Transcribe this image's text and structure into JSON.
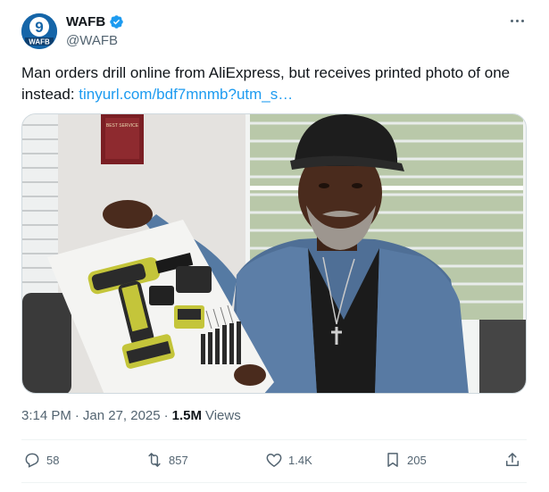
{
  "author": {
    "display_name": "WAFB",
    "handle": "@WAFB",
    "avatar_icon": "wafb-9-logo-icon",
    "verified_icon": "verified-badge-icon",
    "avatar_logo_number": "9",
    "avatar_logo_text": "WAFB"
  },
  "tweet": {
    "text": "Man orders drill online from AliExpress, but receives printed photo of one instead: ",
    "link_text": "tinyurl.com/bdf7mnmb?utm_s…"
  },
  "media": {
    "description_icon": "photo-man-holding-printed-drill-photo",
    "plaque_text": "BEST SERVICE"
  },
  "meta": {
    "time": "3:14 PM",
    "separator": "·",
    "date": "Jan 27, 2025",
    "views_count": "1.5M",
    "views_label": "Views"
  },
  "actions": {
    "replies": "58",
    "reposts": "857",
    "likes": "1.4K",
    "bookmarks": "205"
  },
  "colors": {
    "link": "#1d9bf0",
    "verified": "#1d9bf0",
    "secondary_text": "#536471",
    "brand_blue": "#1565a8"
  }
}
